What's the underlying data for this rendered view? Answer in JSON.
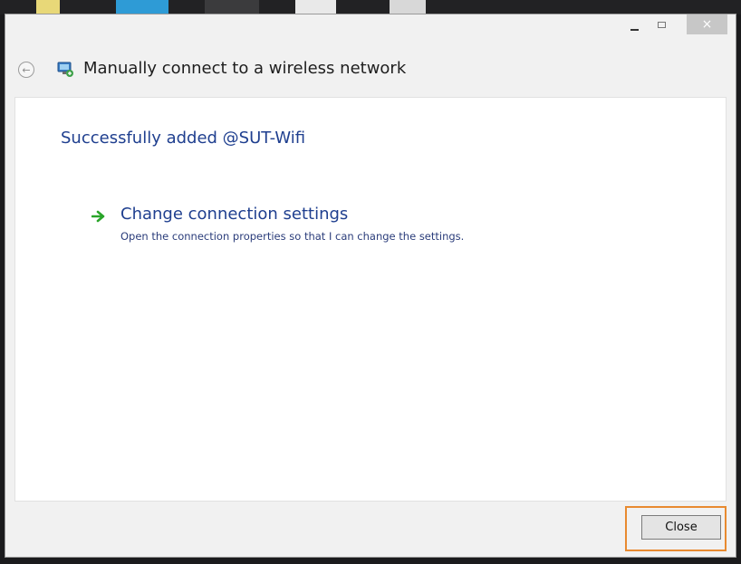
{
  "window": {
    "title": "Manually connect to a wireless network",
    "controls": {
      "minimize_icon": "minimize-icon",
      "maximize_icon": "maximize-icon",
      "close_glyph": "×"
    }
  },
  "nav": {
    "back_icon": "back-arrow-icon",
    "back_glyph": "←",
    "app_icon": "network-icon"
  },
  "content": {
    "headline": "Successfully added @SUT-Wifi",
    "link": {
      "icon": "green-arrow-icon",
      "title": "Change connection settings",
      "description": "Open the connection properties so that I can change the settings."
    }
  },
  "footer": {
    "close_label": "Close"
  },
  "colors": {
    "link": "#1f3f8f",
    "highlight": "#e88a30",
    "arrow": "#2aa52a"
  }
}
